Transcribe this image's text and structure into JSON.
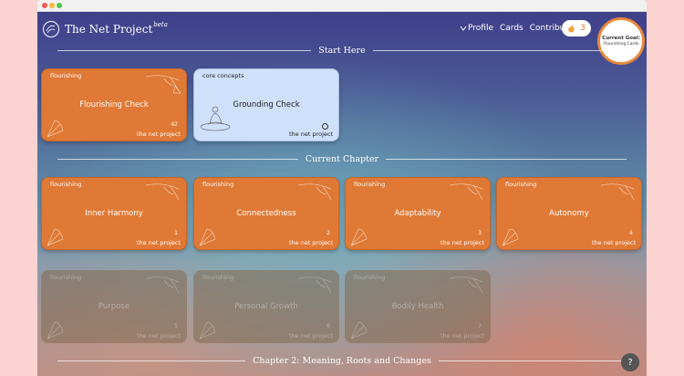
{
  "app": {
    "title": "The Net Project",
    "beta": "beta"
  },
  "nav": {
    "profile": "Profile",
    "cards": "Cards",
    "contribute": "Contribute",
    "streak_count": "3",
    "streak_icon": "fire-icon"
  },
  "goal": {
    "title": "Current Goal:",
    "value": "Flourishing Cards"
  },
  "sections": {
    "start_here": "Start Here",
    "current_chapter": "Current Chapter",
    "chapter2": "Chapter 2: Meaning, Roots and Changes"
  },
  "brand": "the net project",
  "start_cards": [
    {
      "tag": "flourishing",
      "name": "Flourishing Check",
      "num": "42"
    },
    {
      "tag": "core concepts",
      "name": "Grounding Check",
      "num": ""
    }
  ],
  "chapter_cards": [
    {
      "tag": "flourishing",
      "name": "Inner Harmony",
      "num": "1"
    },
    {
      "tag": "flourishing",
      "name": "Connectedness",
      "num": "2"
    },
    {
      "tag": "flourishing",
      "name": "Adaptability",
      "num": "3"
    },
    {
      "tag": "flourishing",
      "name": "Autonomy",
      "num": "4"
    }
  ],
  "locked_cards": [
    {
      "tag": "flourishing",
      "name": "Purpose",
      "num": "5"
    },
    {
      "tag": "flourishing",
      "name": "Personal Growth",
      "num": "6"
    },
    {
      "tag": "flourishing",
      "name": "Bodily Health",
      "num": "7"
    }
  ],
  "help": "?",
  "colors": {
    "card_orange": "#e07935",
    "card_blue": "#cfe0fb",
    "accent": "#e7893c"
  }
}
